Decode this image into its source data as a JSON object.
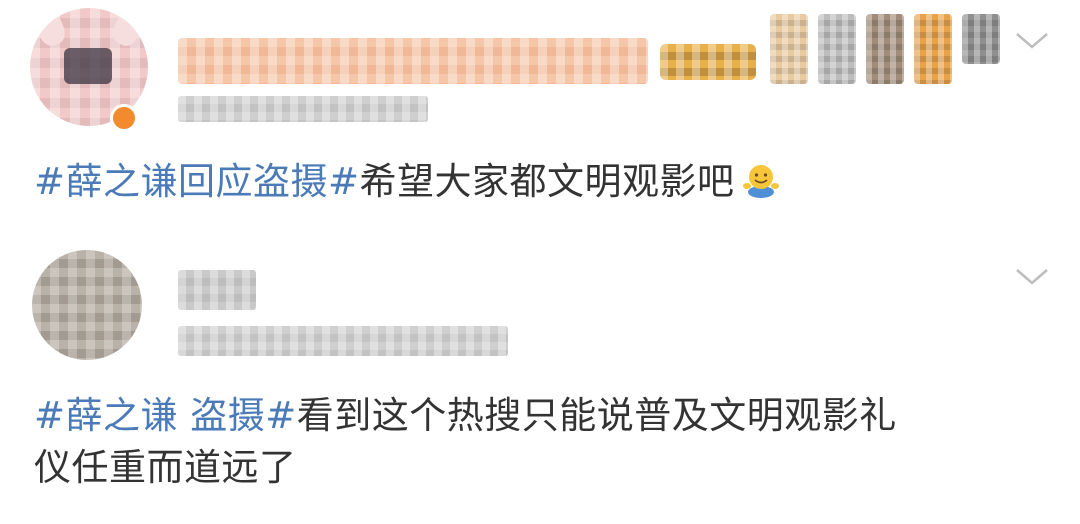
{
  "posts": [
    {
      "hashtag": "#薛之谦回应盗摄#",
      "text": "希望大家都文明观影吧",
      "emoji": "smiling-face-emoji"
    },
    {
      "hashtag": "#薛之谦 盗摄#",
      "text_line1": "看到这个热搜只能说普及文明观影礼",
      "text_line2": "仪任重而道远了"
    }
  ],
  "icons": {
    "expand": "chevron-down-icon",
    "blurred": "pixelated-content"
  },
  "colors": {
    "hashtag": "#4a7ab8",
    "text": "#333333",
    "chevron": "#bdbdbd"
  }
}
